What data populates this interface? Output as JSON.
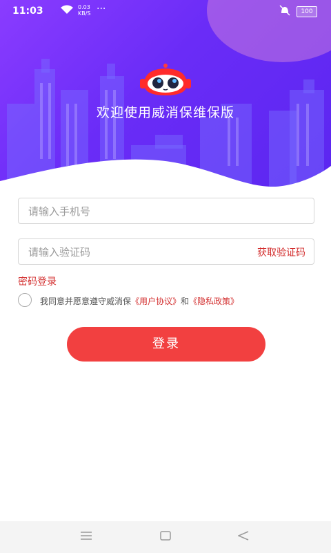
{
  "status_bar": {
    "time": "11:03",
    "speed_value": "0.03",
    "speed_unit": "KB/S",
    "dots": "···",
    "battery": "100"
  },
  "header": {
    "welcome": "欢迎使用威消保维保版"
  },
  "form": {
    "phone_placeholder": "请输入手机号",
    "code_placeholder": "请输入验证码",
    "get_code": "获取验证码",
    "password_login": "密码登录",
    "agreement_prefix": "我同意并愿意遵守威消保",
    "user_agreement": "《用户协议》",
    "and": "和",
    "privacy_policy": "《隐私政策》",
    "login_button": "登录"
  },
  "nav": {
    "menu": "menu-icon",
    "home": "home-square-icon",
    "back": "back-triangle-icon"
  },
  "colors": {
    "accent": "#f24040",
    "link": "#d32f2f",
    "header_gradient_start": "#8a3cff",
    "header_gradient_end": "#5b26f0"
  }
}
